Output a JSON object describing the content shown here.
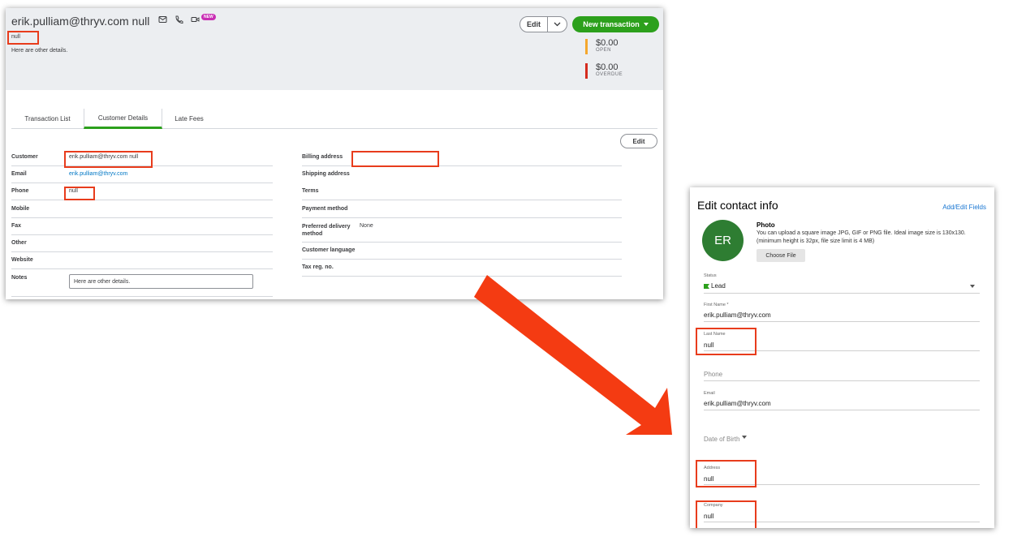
{
  "customer_page": {
    "title": "erik.pulliam@thryv.com null",
    "new_badge": "NEW",
    "subtitle": "null",
    "description": "Here are other details.",
    "edit_label": "Edit",
    "new_transaction_label": "New transaction",
    "open_amount": "$0.00",
    "open_label": "OPEN",
    "overdue_amount": "$0.00",
    "overdue_label": "OVERDUE",
    "tabs": [
      "Transaction List",
      "Customer Details",
      "Late Fees"
    ],
    "details_edit_label": "Edit",
    "left_fields": [
      {
        "label": "Customer",
        "value": "erik.pulliam@thryv.com null"
      },
      {
        "label": "Email",
        "value": "erik.pulliam@thryv.com"
      },
      {
        "label": "Phone",
        "value": "null"
      },
      {
        "label": "Mobile",
        "value": ""
      },
      {
        "label": "Fax",
        "value": ""
      },
      {
        "label": "Other",
        "value": ""
      },
      {
        "label": "Website",
        "value": ""
      },
      {
        "label": "Notes",
        "value": "Here are other details."
      }
    ],
    "right_fields": [
      {
        "label": "Billing address",
        "value": ""
      },
      {
        "label": "Shipping address",
        "value": ""
      },
      {
        "label": "Terms",
        "value": ""
      },
      {
        "label": "Payment method",
        "value": ""
      },
      {
        "label": "Preferred delivery method",
        "value": "None"
      },
      {
        "label": "Customer language",
        "value": ""
      },
      {
        "label": "Tax reg. no.",
        "value": ""
      }
    ],
    "accent_green": "#2ca01c",
    "open_color": "#f4a72d",
    "overdue_color": "#d52b1e"
  },
  "edit_contact": {
    "title": "Edit contact info",
    "add_edit_fields": "Add/Edit Fields",
    "avatar_initials": "ER",
    "photo_heading": "Photo",
    "photo_text": "You can upload a square image JPG, GIF or PNG file. Ideal image size is 130x130. (minimum height is 32px, file size limit is 4 MB)",
    "choose_file": "Choose File",
    "status_label": "Status",
    "status_value": "Lead",
    "first_name_label": "First Name *",
    "first_name_value": "erik.pulliam@thryv.com",
    "last_name_label": "Last Name",
    "last_name_value": "null",
    "phone_placeholder": "Phone",
    "email_label": "Email",
    "email_value": "erik.pulliam@thryv.com",
    "dob_placeholder": "Date of Birth",
    "address_label": "Address",
    "address_value": "null",
    "company_label": "Company",
    "company_value": "null",
    "avatar_color": "#2e7d32",
    "link_color": "#1976d2"
  },
  "annotation_color": "#e83c1c"
}
